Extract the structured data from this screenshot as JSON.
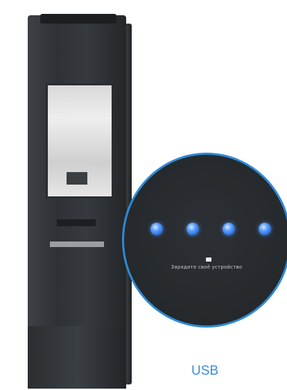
{
  "zoom": {
    "message": "Зарядите своё устройство",
    "dot_count": 4,
    "accent_color": "#2e8ad8",
    "icon": "usb-icon"
  },
  "caption": "USB"
}
